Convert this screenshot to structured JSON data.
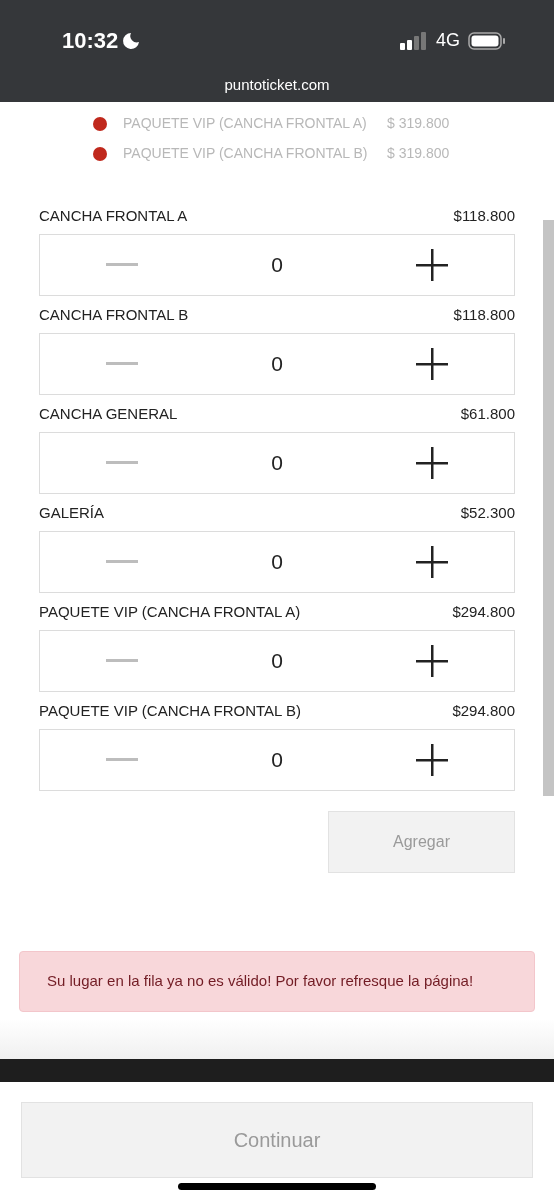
{
  "status_bar": {
    "time": "10:32",
    "network": "4G"
  },
  "browser": {
    "url": "puntoticket.com"
  },
  "price_list": [
    {
      "name": "PAQUETE VIP (CANCHA FRONTAL A)",
      "price": "$ 319.800",
      "color": "#c0281c"
    },
    {
      "name": "PAQUETE VIP (CANCHA FRONTAL B)",
      "price": "$ 319.800",
      "color": "#c0281c"
    }
  ],
  "tickets": [
    {
      "name": "CANCHA FRONTAL A",
      "price": "$118.800",
      "quantity": "0",
      "minus_disabled": true
    },
    {
      "name": "CANCHA FRONTAL B",
      "price": "$118.800",
      "quantity": "0",
      "minus_disabled": true
    },
    {
      "name": "CANCHA GENERAL",
      "price": "$61.800",
      "quantity": "0",
      "minus_disabled": true
    },
    {
      "name": "GALERÍA",
      "price": "$52.300",
      "quantity": "0",
      "minus_disabled": true
    },
    {
      "name": "PAQUETE VIP (CANCHA FRONTAL A)",
      "price": "$294.800",
      "quantity": "0",
      "minus_disabled": true
    },
    {
      "name": "PAQUETE VIP (CANCHA FRONTAL B)",
      "price": "$294.800",
      "quantity": "0",
      "minus_disabled": true
    }
  ],
  "add_button": {
    "label": "Agregar",
    "disabled": true
  },
  "alert": {
    "message": "Su lugar en la fila ya no es válido! Por favor refresque la página!"
  },
  "continue_button": {
    "label": "Continuar",
    "disabled": true
  }
}
